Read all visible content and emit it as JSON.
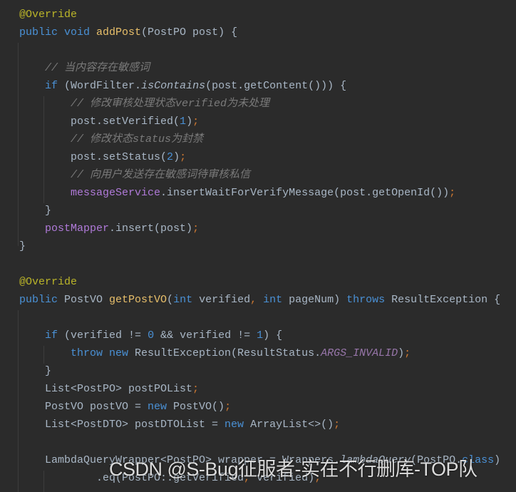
{
  "editor": {
    "colors": {
      "background": "#2b2b2b",
      "text": "#a9b7c6",
      "keyword": "#4a91d6",
      "function": "#e8bf6a",
      "annotation": "#bbb529",
      "comment": "#7a7a7a",
      "constant": "#9876aa"
    },
    "lines": [
      [
        [
          "@Override",
          "an"
        ]
      ],
      [
        [
          "public void ",
          "kw"
        ],
        [
          "addPost",
          "fn"
        ],
        [
          "(PostPO post) {",
          ""
        ]
      ],
      [],
      [
        [
          "    ",
          ""
        ],
        [
          "// 当内容存在敏感词",
          "cm"
        ]
      ],
      [
        [
          "    ",
          ""
        ],
        [
          "if ",
          "kw"
        ],
        [
          "(WordFilter.",
          ""
        ],
        [
          "isContains",
          "it"
        ],
        [
          "(post.getContent())) {",
          ""
        ]
      ],
      [
        [
          "        ",
          ""
        ],
        [
          "// 修改审核处理状态verified为未处理",
          "cm"
        ]
      ],
      [
        [
          "        post.setVerified(",
          ""
        ],
        [
          "1",
          "nm"
        ],
        [
          ")",
          ""
        ],
        [
          ";",
          "pu"
        ]
      ],
      [
        [
          "        ",
          ""
        ],
        [
          "// 修改状态status为封禁",
          "cm"
        ]
      ],
      [
        [
          "        post.setStatus(",
          ""
        ],
        [
          "2",
          "nm"
        ],
        [
          ")",
          ""
        ],
        [
          ";",
          "pu"
        ]
      ],
      [
        [
          "        ",
          ""
        ],
        [
          "// 向用户发送存在敏感词待审核私信",
          "cm"
        ]
      ],
      [
        [
          "        ",
          ""
        ],
        [
          "messageService",
          "fd"
        ],
        [
          ".insertWaitForVerifyMessage(post.getOpenId())",
          ""
        ],
        [
          ";",
          "pu"
        ]
      ],
      [
        [
          "    }",
          ""
        ]
      ],
      [
        [
          "    ",
          ""
        ],
        [
          "postMapper",
          "fd"
        ],
        [
          ".insert(post)",
          ""
        ],
        [
          ";",
          "pu"
        ]
      ],
      [
        [
          "}",
          ""
        ]
      ],
      [],
      [
        [
          "@Override",
          "an"
        ]
      ],
      [
        [
          "public ",
          "kw"
        ],
        [
          "PostVO ",
          ""
        ],
        [
          "getPostVO",
          "fn"
        ],
        [
          "(",
          ""
        ],
        [
          "int ",
          "kw"
        ],
        [
          "verified",
          ""
        ],
        [
          ", ",
          "pu"
        ],
        [
          "int ",
          "kw"
        ],
        [
          "pageNum) ",
          ""
        ],
        [
          "throws ",
          "kw"
        ],
        [
          "ResultException {",
          ""
        ]
      ],
      [],
      [
        [
          "    ",
          ""
        ],
        [
          "if ",
          "kw"
        ],
        [
          "(verified != ",
          ""
        ],
        [
          "0",
          "nm"
        ],
        [
          " && verified != ",
          ""
        ],
        [
          "1",
          "nm"
        ],
        [
          ") {",
          ""
        ]
      ],
      [
        [
          "        ",
          ""
        ],
        [
          "throw new ",
          "kw"
        ],
        [
          "ResultException(ResultStatus.",
          ""
        ],
        [
          "ARGS_INVALID",
          "cs"
        ],
        [
          ")",
          ""
        ],
        [
          ";",
          "pu"
        ]
      ],
      [
        [
          "    }",
          ""
        ]
      ],
      [
        [
          "    List<PostPO> postPOList",
          ""
        ],
        [
          ";",
          "pu"
        ]
      ],
      [
        [
          "    PostVO postVO = ",
          ""
        ],
        [
          "new ",
          "kw"
        ],
        [
          "PostVO()",
          ""
        ],
        [
          ";",
          "pu"
        ]
      ],
      [
        [
          "    List<PostDTO> postDTOList = ",
          ""
        ],
        [
          "new ",
          "kw"
        ],
        [
          "ArrayList<>()",
          ""
        ],
        [
          ";",
          "pu"
        ]
      ],
      [],
      [
        [
          "    LambdaQueryWrapper<PostPO> wrapper = Wrappers.",
          ""
        ],
        [
          "lambdaQuery",
          "it"
        ],
        [
          "(PostPO.",
          ""
        ],
        [
          "class",
          "kw"
        ],
        [
          ")",
          ""
        ]
      ],
      [
        [
          "            .eq(PostPO::getVerified",
          ""
        ],
        [
          ", ",
          "pu"
        ],
        [
          "verified)",
          ""
        ],
        [
          ";",
          "pu"
        ]
      ]
    ]
  },
  "watermark": "CSDN @S-Bug征服者-实在不行删库-TOP队"
}
